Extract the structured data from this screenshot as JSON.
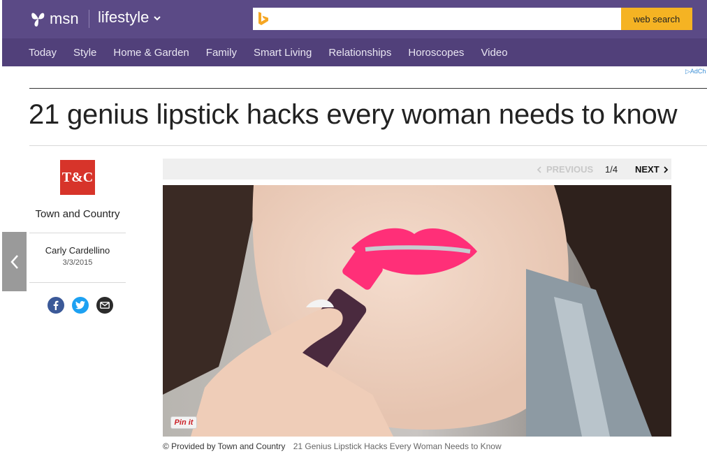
{
  "header": {
    "brand": "msn",
    "section": "lifestyle",
    "search_button": "web search",
    "search_value": ""
  },
  "nav": {
    "items": [
      "Today",
      "Style",
      "Home & Garden",
      "Family",
      "Smart Living",
      "Relationships",
      "Horoscopes",
      "Video"
    ]
  },
  "ad": {
    "label": "AdCh"
  },
  "article": {
    "title": "21 genius lipstick hacks every woman needs to know",
    "provider_logo": "T&C",
    "provider": "Town and Country",
    "author": "Carly Cardellino",
    "date": "3/3/2015"
  },
  "slideshow": {
    "previous_label": "PREVIOUS",
    "next_label": "NEXT",
    "counter": "1/4",
    "pin_label": "Pin it",
    "caption_credit": "© Provided by Town and Country",
    "caption_title": "21 Genius Lipstick Hacks Every Woman Needs to Know"
  },
  "colors": {
    "header_bg": "#5b4a86",
    "nav_bg": "#51407a",
    "search_btn": "#f5b323",
    "provider_red": "#d7342a",
    "lipstick_pink": "#ff2f78"
  },
  "icons": [
    "msn-butterfly-icon",
    "chevron-down-icon",
    "bing-icon",
    "chevron-left-icon",
    "chevron-right-icon",
    "facebook-icon",
    "twitter-icon",
    "email-icon"
  ]
}
